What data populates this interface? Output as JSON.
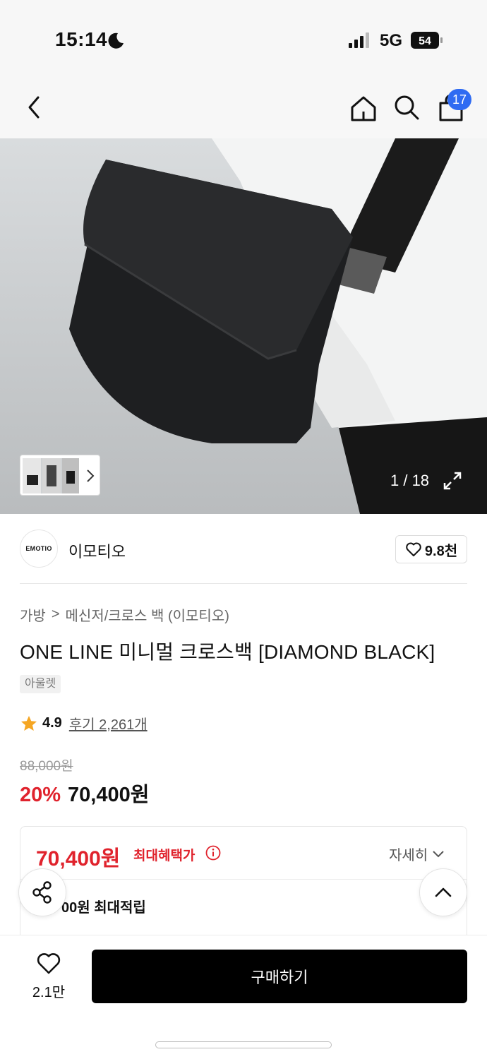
{
  "status_bar": {
    "time": "15:14",
    "network": "5G",
    "battery_level": "54"
  },
  "header": {
    "cart_count": "17"
  },
  "gallery": {
    "counter": "1 / 18"
  },
  "brand": {
    "logo_text": "EMOTIO",
    "name": "이모티오",
    "likes": "9.8천"
  },
  "breadcrumb": {
    "category": "가방",
    "separator": ">",
    "subcategory": "메신저/크로스 백 (이모티오)"
  },
  "product": {
    "title": "ONE LINE 미니멀 크로스백 [DIAMOND BLACK]",
    "badge": "아울렛",
    "rating": "4.9",
    "reviews_label": "후기 2,261개",
    "original_price": "88,000원",
    "discount_rate": "20%",
    "sale_price": "70,400원"
  },
  "benefit": {
    "max_price": "70,400원",
    "max_label": "최대혜택가",
    "details_label": "자세히",
    "points_text": "00원 최대적립"
  },
  "bottom_bar": {
    "wish_count": "2.1만",
    "buy_label": "구매하기"
  },
  "colors": {
    "accent_red": "#e0232d",
    "badge_blue": "#2f6bf2"
  }
}
